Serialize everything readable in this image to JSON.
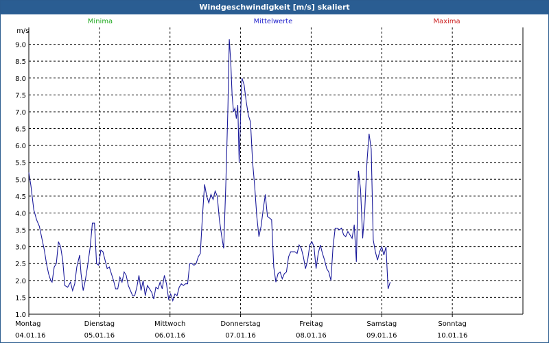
{
  "window": {
    "title": "Windgeschwindigkeit [m/s] skaliert"
  },
  "colors": {
    "minima": "#22aa22",
    "mittelwerte": "#2222cc",
    "maxima": "#cc2222",
    "line": "#1a1a9a",
    "titlebar": "#2a5d92"
  },
  "chart_data": {
    "type": "line",
    "unit_label": "m/s",
    "legend": [
      "Minima",
      "Mittelwerte",
      "Maxima"
    ],
    "ylim": [
      1.0,
      9.5
    ],
    "yticks": [
      "1.0",
      "1.5",
      "2.0",
      "2.5",
      "3.0",
      "3.5",
      "4.0",
      "4.5",
      "5.0",
      "5.5",
      "6.0",
      "6.5",
      "7.0",
      "7.5",
      "8.0",
      "8.5",
      "9.0"
    ],
    "xlim": [
      0,
      7
    ],
    "day_labels": [
      {
        "day": "Montag",
        "date": "04.01.16"
      },
      {
        "day": "Dienstag",
        "date": "05.01.16"
      },
      {
        "day": "Mittwoch",
        "date": "06.01.16"
      },
      {
        "day": "Donnerstag",
        "date": "07.01.16"
      },
      {
        "day": "Freitag",
        "date": "08.01.16"
      },
      {
        "day": "Samstag",
        "date": "09.01.16"
      },
      {
        "day": "Sonntag",
        "date": "10.01.16"
      }
    ],
    "grid": true,
    "series": [
      {
        "name": "Mittelwerte",
        "points": [
          [
            0.0,
            5.2
          ],
          [
            0.03,
            4.8
          ],
          [
            0.07,
            4.1
          ],
          [
            0.11,
            3.8
          ],
          [
            0.15,
            3.6
          ],
          [
            0.19,
            3.2
          ],
          [
            0.22,
            2.9
          ],
          [
            0.25,
            2.5
          ],
          [
            0.28,
            2.2
          ],
          [
            0.31,
            2.0
          ],
          [
            0.33,
            1.95
          ],
          [
            0.36,
            2.4
          ],
          [
            0.39,
            2.5
          ],
          [
            0.42,
            3.15
          ],
          [
            0.45,
            3.0
          ],
          [
            0.48,
            2.6
          ],
          [
            0.51,
            1.85
          ],
          [
            0.55,
            1.8
          ],
          [
            0.59,
            1.95
          ],
          [
            0.62,
            1.7
          ],
          [
            0.65,
            1.9
          ],
          [
            0.68,
            2.4
          ],
          [
            0.72,
            2.75
          ],
          [
            0.74,
            2.2
          ],
          [
            0.77,
            1.7
          ],
          [
            0.8,
            2.0
          ],
          [
            0.83,
            2.4
          ],
          [
            0.87,
            3.0
          ],
          [
            0.9,
            3.7
          ],
          [
            0.93,
            3.7
          ],
          [
            0.96,
            2.5
          ],
          [
            0.99,
            2.45
          ],
          [
            1.02,
            2.9
          ],
          [
            1.05,
            2.85
          ],
          [
            1.08,
            2.6
          ],
          [
            1.11,
            2.35
          ],
          [
            1.14,
            2.4
          ],
          [
            1.17,
            2.2
          ],
          [
            1.2,
            2.0
          ],
          [
            1.23,
            1.75
          ],
          [
            1.26,
            1.75
          ],
          [
            1.29,
            2.1
          ],
          [
            1.32,
            1.95
          ],
          [
            1.35,
            2.25
          ],
          [
            1.38,
            2.15
          ],
          [
            1.41,
            1.85
          ],
          [
            1.44,
            1.7
          ],
          [
            1.47,
            1.55
          ],
          [
            1.5,
            1.55
          ],
          [
            1.53,
            1.8
          ],
          [
            1.56,
            2.15
          ],
          [
            1.59,
            1.7
          ],
          [
            1.62,
            2.0
          ],
          [
            1.65,
            1.55
          ],
          [
            1.68,
            1.85
          ],
          [
            1.71,
            1.75
          ],
          [
            1.74,
            1.65
          ],
          [
            1.77,
            1.45
          ],
          [
            1.8,
            1.8
          ],
          [
            1.83,
            1.75
          ],
          [
            1.86,
            1.95
          ],
          [
            1.89,
            1.75
          ],
          [
            1.92,
            2.15
          ],
          [
            1.95,
            1.9
          ],
          [
            1.98,
            1.45
          ],
          [
            2.01,
            1.6
          ],
          [
            2.04,
            1.4
          ],
          [
            2.07,
            1.6
          ],
          [
            2.1,
            1.55
          ],
          [
            2.13,
            1.8
          ],
          [
            2.16,
            1.9
          ],
          [
            2.19,
            1.85
          ],
          [
            2.22,
            1.9
          ],
          [
            2.25,
            1.9
          ],
          [
            2.28,
            2.5
          ],
          [
            2.31,
            2.5
          ],
          [
            2.34,
            2.45
          ],
          [
            2.37,
            2.5
          ],
          [
            2.4,
            2.7
          ],
          [
            2.43,
            2.8
          ],
          [
            2.46,
            3.9
          ],
          [
            2.49,
            4.85
          ],
          [
            2.52,
            4.5
          ],
          [
            2.55,
            4.3
          ],
          [
            2.58,
            4.55
          ],
          [
            2.61,
            4.4
          ],
          [
            2.64,
            4.65
          ],
          [
            2.67,
            4.5
          ],
          [
            2.7,
            3.8
          ],
          [
            2.73,
            3.35
          ],
          [
            2.76,
            2.95
          ],
          [
            2.79,
            4.8
          ],
          [
            2.82,
            7.1
          ],
          [
            2.84,
            9.15
          ],
          [
            2.86,
            8.5
          ],
          [
            2.88,
            7.5
          ],
          [
            2.9,
            7.0
          ],
          [
            2.92,
            7.1
          ],
          [
            2.94,
            6.8
          ],
          [
            2.96,
            7.2
          ],
          [
            2.98,
            5.5
          ],
          [
            3.0,
            6.9
          ],
          [
            3.02,
            8.0
          ],
          [
            3.05,
            7.8
          ],
          [
            3.08,
            7.3
          ],
          [
            3.11,
            6.9
          ],
          [
            3.14,
            6.7
          ],
          [
            3.17,
            5.5
          ],
          [
            3.2,
            4.8
          ],
          [
            3.23,
            3.9
          ],
          [
            3.26,
            3.3
          ],
          [
            3.29,
            3.6
          ],
          [
            3.32,
            4.1
          ],
          [
            3.35,
            4.55
          ],
          [
            3.38,
            3.9
          ],
          [
            3.41,
            3.85
          ],
          [
            3.44,
            3.8
          ],
          [
            3.47,
            2.4
          ],
          [
            3.5,
            1.95
          ],
          [
            3.53,
            2.2
          ],
          [
            3.56,
            2.25
          ],
          [
            3.59,
            2.05
          ],
          [
            3.62,
            2.2
          ],
          [
            3.65,
            2.25
          ],
          [
            3.68,
            2.7
          ],
          [
            3.71,
            2.85
          ],
          [
            3.74,
            2.85
          ],
          [
            3.77,
            2.85
          ],
          [
            3.8,
            2.8
          ],
          [
            3.83,
            3.05
          ],
          [
            3.86,
            2.95
          ],
          [
            3.89,
            2.7
          ],
          [
            3.92,
            2.35
          ],
          [
            3.95,
            2.6
          ],
          [
            3.98,
            3.05
          ],
          [
            4.01,
            3.15
          ],
          [
            4.04,
            3.0
          ],
          [
            4.07,
            2.35
          ],
          [
            4.1,
            2.8
          ],
          [
            4.13,
            3.05
          ],
          [
            4.16,
            2.8
          ],
          [
            4.19,
            2.6
          ],
          [
            4.22,
            2.35
          ],
          [
            4.25,
            2.25
          ],
          [
            4.28,
            2.0
          ],
          [
            4.31,
            3.0
          ],
          [
            4.34,
            3.55
          ],
          [
            4.37,
            3.55
          ],
          [
            4.4,
            3.5
          ],
          [
            4.43,
            3.55
          ],
          [
            4.46,
            3.35
          ],
          [
            4.49,
            3.3
          ],
          [
            4.52,
            3.45
          ],
          [
            4.55,
            3.35
          ],
          [
            4.58,
            3.25
          ],
          [
            4.61,
            3.65
          ],
          [
            4.64,
            2.55
          ],
          [
            4.67,
            5.25
          ],
          [
            4.7,
            4.7
          ],
          [
            4.73,
            3.25
          ],
          [
            4.76,
            4.1
          ],
          [
            4.79,
            5.5
          ],
          [
            4.82,
            6.35
          ],
          [
            4.85,
            5.9
          ],
          [
            4.88,
            3.2
          ],
          [
            4.91,
            2.85
          ],
          [
            4.94,
            2.6
          ],
          [
            4.97,
            2.85
          ],
          [
            5.0,
            3.0
          ],
          [
            5.03,
            2.75
          ],
          [
            5.06,
            3.0
          ],
          [
            5.09,
            1.75
          ],
          [
            5.12,
            1.95
          ]
        ]
      }
    ]
  }
}
